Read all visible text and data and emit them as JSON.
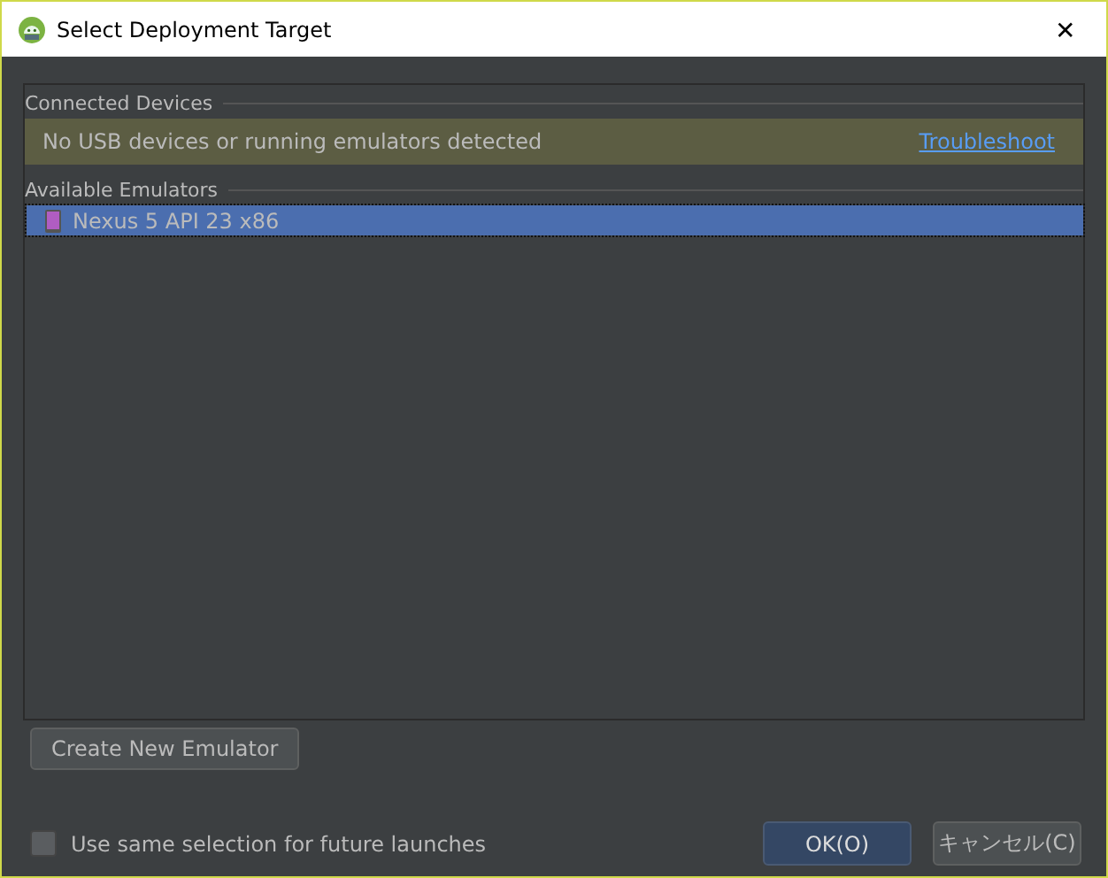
{
  "window": {
    "title": "Select Deployment Target",
    "close": "✕"
  },
  "connected": {
    "heading": "Connected Devices",
    "message": "No USB devices or running emulators detected",
    "link": "Troubleshoot"
  },
  "emulators": {
    "heading": "Available Emulators",
    "items": [
      {
        "name": "Nexus 5 API 23 x86",
        "selected": true
      }
    ]
  },
  "create_button": "Create New Emulator",
  "remember": {
    "label": "Use same selection for future launches",
    "checked": false
  },
  "buttons": [
    {
      "label": "OK(O)",
      "kind": "primary"
    },
    {
      "label": "キャンセル(C)",
      "kind": "normal"
    }
  ]
}
